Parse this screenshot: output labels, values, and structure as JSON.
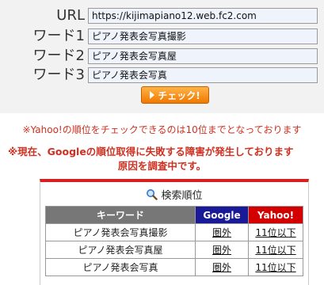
{
  "form": {
    "url_label": "URL",
    "url_value": "https://kijimapiano12.web.fc2.com",
    "word1_label": "ワード1",
    "word1_value": "ピアノ発表会写真撮影",
    "word2_label": "ワード2",
    "word2_value": "ピアノ発表会写真屋",
    "word3_label": "ワード3",
    "word3_value": "ピアノ発表会写真",
    "check_button": "チェック!"
  },
  "notices": {
    "limit": "※Yahoo!の順位をチェックできるのは10位までとなっております",
    "error_line1": "※現在、Googleの順位取得に失敗する障害が発生しております",
    "error_line2": "原因を調査中です。"
  },
  "results": {
    "title": "検索順位",
    "headers": {
      "keyword": "キーワード",
      "google": "Google",
      "yahoo": "Yahoo!"
    },
    "rows": [
      {
        "keyword": "ピアノ発表会写真撮影",
        "google": "圏外",
        "yahoo": "11位以下"
      },
      {
        "keyword": "ピアノ発表会写真屋",
        "google": "圏外",
        "yahoo": "11位以下"
      },
      {
        "keyword": "ピアノ発表会写真",
        "google": "圏外",
        "yahoo": "11位以下"
      }
    ]
  },
  "colors": {
    "accent_red": "#d81e1e",
    "google_header": "#1a1a99",
    "yahoo_header": "#d40000",
    "button_orange": "#f07800"
  },
  "icons": {
    "results_title": "magnifier-icon",
    "button": "play-arrow-icon"
  }
}
